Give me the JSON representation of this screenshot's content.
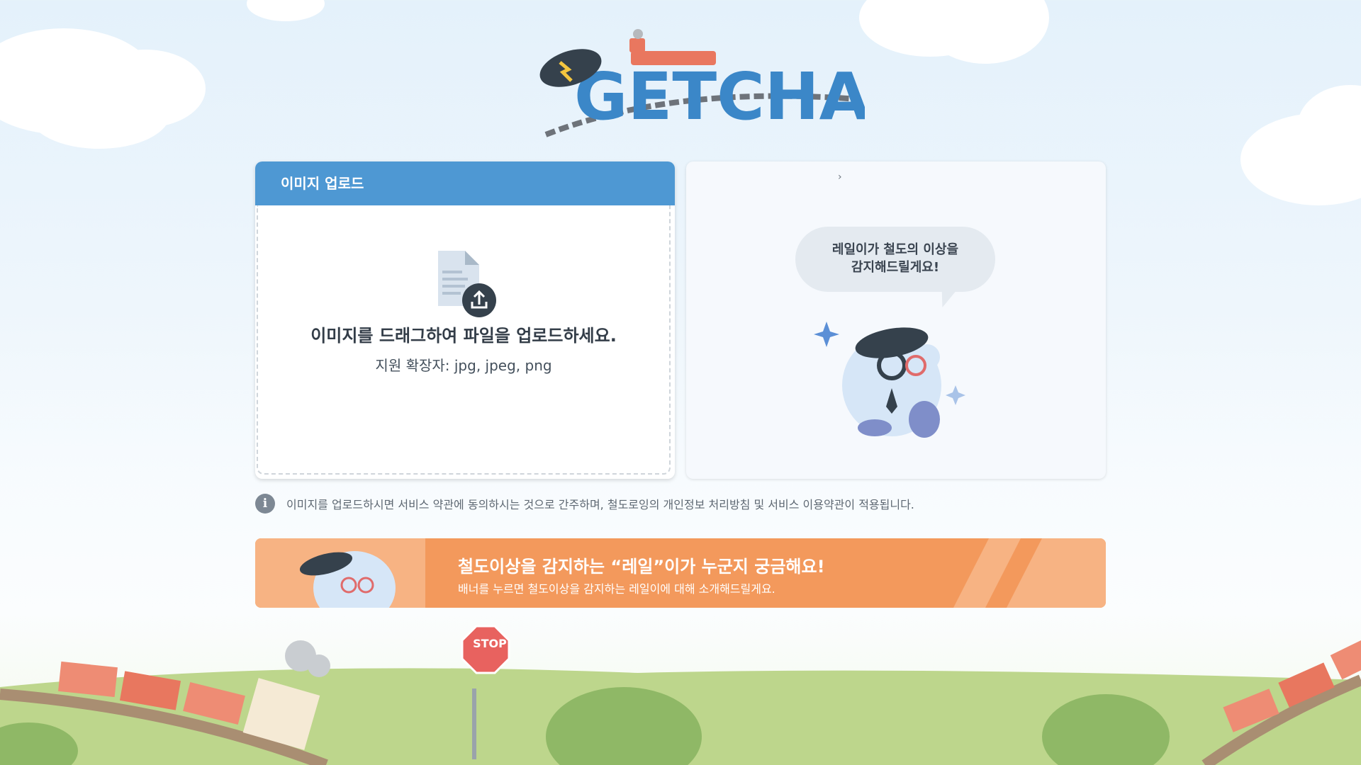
{
  "logo": {
    "text": "GETCHA"
  },
  "upload": {
    "header": "이미지 업로드",
    "main_text": "이미지를 드래그하여 파일을 업로드하세요.",
    "sub_text": "지원 확장자: jpg, jpeg, png"
  },
  "mascot_panel": {
    "chevron": "›",
    "bubble_line1": "레일이가 철도의 이상을",
    "bubble_line2": "감지해드릴게요!"
  },
  "notice": {
    "icon": "i",
    "text": "이미지를 업로드하시면 서비스 약관에 동의하시는 것으로 간주하며, 철도로잉의 개인정보 처리방침 및 서비스 이용약관이 적용됩니다."
  },
  "banner": {
    "title": "철도이상을 감지하는 “레일”이가 누군지 궁금해요!",
    "subtitle": "배너를 누르면 철도이상을 감지하는 레일이에 대해 소개해드릴게요."
  },
  "stop_sign": {
    "text": "STOP"
  },
  "colors": {
    "header_blue": "#4e98d3",
    "banner_orange": "#f3995c",
    "bubble_gray": "#e4eaf0",
    "grass_green": "#bdd68c"
  }
}
